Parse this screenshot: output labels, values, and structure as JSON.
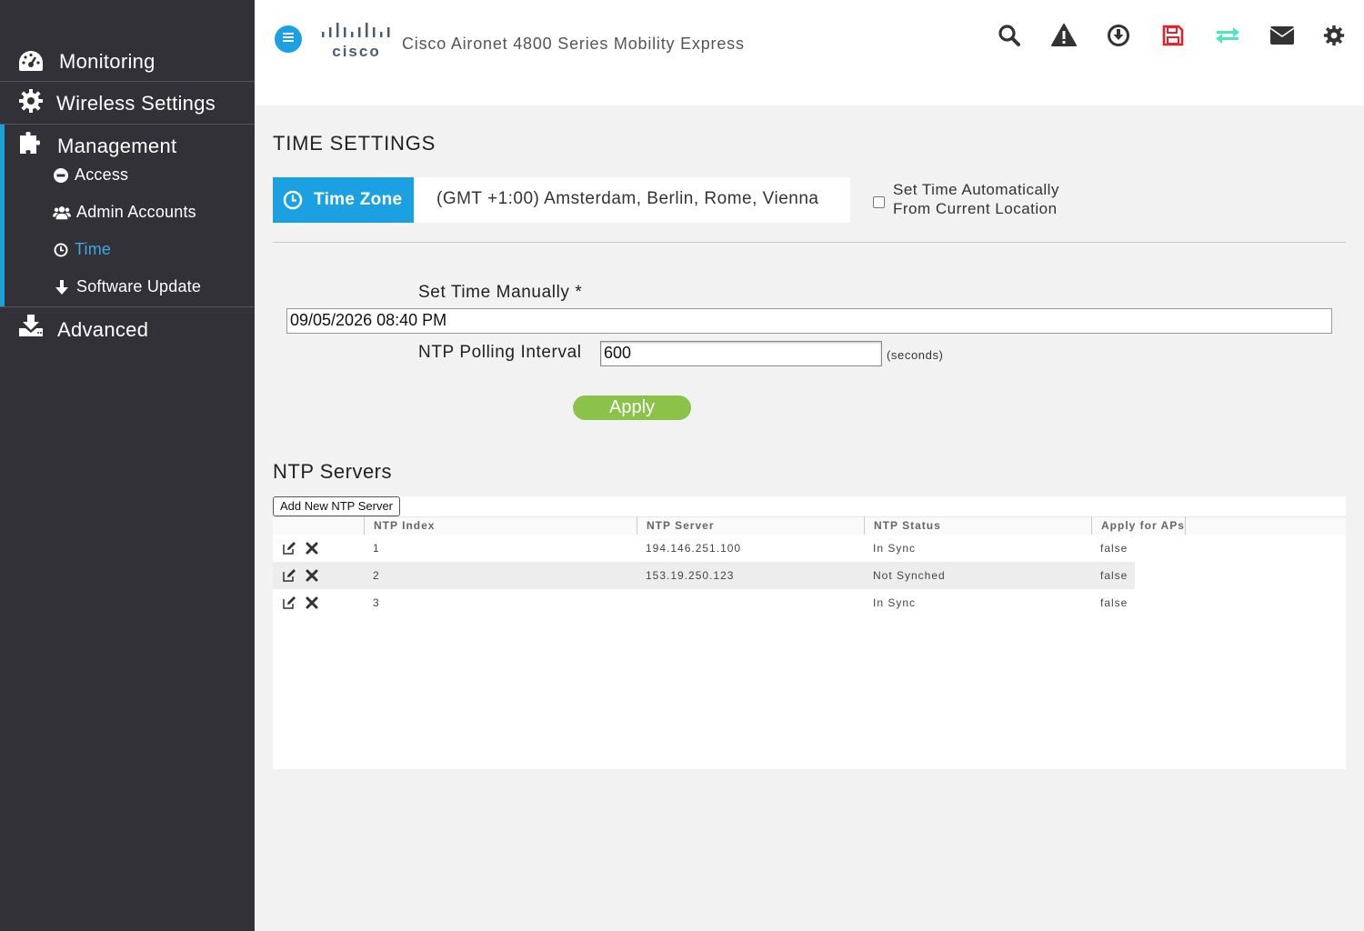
{
  "sidebar": {
    "items": [
      {
        "label": "Monitoring",
        "icon": "dashboard-icon"
      },
      {
        "label": "Wireless Settings",
        "icon": "gear-icon"
      },
      {
        "label": "Management",
        "icon": "puzzle-icon"
      },
      {
        "label": "Advanced",
        "icon": "download-tray-icon"
      }
    ],
    "management_sub": [
      {
        "label": "Access",
        "icon": "minus-circle-icon"
      },
      {
        "label": "Admin Accounts",
        "icon": "users-icon"
      },
      {
        "label": "Time",
        "icon": "clock-icon",
        "active": true
      },
      {
        "label": "Software Update",
        "icon": "arrow-down-icon"
      }
    ],
    "accent_color": "#1ba0d7"
  },
  "header": {
    "logo_text": "cisco",
    "product_title": "Cisco Aironet 4800 Series Mobility Express",
    "icons": [
      "search-icon",
      "warning-icon",
      "download-circle-icon",
      "save-icon",
      "transfer-icon",
      "envelope-icon",
      "settings-icon"
    ],
    "save_icon_color": "#e8202a",
    "transfer_icon_color": "#4de8c0"
  },
  "time_settings": {
    "title": "TIME SETTINGS",
    "timezone_button": "Time Zone",
    "timezone_value": "(GMT +1:00) Amsterdam, Berlin, Rome, Vienna",
    "auto_time_line1": "Set Time Automatically",
    "auto_time_line2": "From Current Location",
    "auto_time_checked": false,
    "manual_label": "Set Time Manually *",
    "manual_value": "09/05/2026 08:40 PM",
    "ntp_interval_label": "NTP Polling Interval",
    "ntp_interval_value": "600",
    "ntp_interval_unit": "(seconds)",
    "apply_label": "Apply"
  },
  "ntp": {
    "title": "NTP Servers",
    "add_button": "Add New NTP Server",
    "columns": [
      "NTP Index",
      "NTP Server",
      "NTP Status",
      "Apply for APs"
    ],
    "rows": [
      {
        "index": "1",
        "server": "194.146.251.100",
        "status": "In Sync",
        "apply": "false"
      },
      {
        "index": "2",
        "server": "153.19.250.123",
        "status": "Not Synched",
        "apply": "false"
      },
      {
        "index": "3",
        "server": "",
        "status": "In Sync",
        "apply": "false"
      }
    ]
  }
}
